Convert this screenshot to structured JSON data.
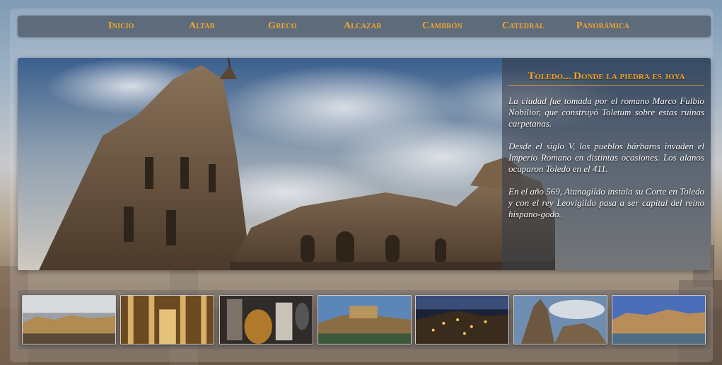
{
  "nav": {
    "items": [
      {
        "label": "Inicio"
      },
      {
        "label": "Altar"
      },
      {
        "label": "Greco"
      },
      {
        "label": "Alcazar"
      },
      {
        "label": "Cambrón"
      },
      {
        "label": "Catedral"
      },
      {
        "label": "Panorámica"
      }
    ]
  },
  "hero": {
    "image": "toledo-cathedral-photo",
    "title": "Toledo... Donde la piedra es joya",
    "paragraphs": [
      "La ciudad fue tomada por el romano Marco Fulbio Nobilior, que construyó Toletum sobre estas ruinas carpetanas.",
      "Desde el siglo V, los pueblos bárbaros invaden el Imperio Romano en distintas ocasiones. Los alanos ocuparon Toledo en el 411.",
      "En el año 569, Atanagildo instala su Corte en Toledo y con el rey Leovigildo pasa a ser capital del reino hispano-godo."
    ]
  },
  "thumbnails": [
    {
      "subject": "toledo-skyline-photo"
    },
    {
      "subject": "cathedral-altar-photo"
    },
    {
      "subject": "greco-painting-photo"
    },
    {
      "subject": "alcazar-photo"
    },
    {
      "subject": "toledo-night-photo"
    },
    {
      "subject": "cathedral-tower-photo"
    },
    {
      "subject": "panoramic-photo"
    }
  ],
  "colors": {
    "accent": "#f4a62a",
    "nav_bg": "#46525f",
    "caption_text": "#ffffff"
  }
}
